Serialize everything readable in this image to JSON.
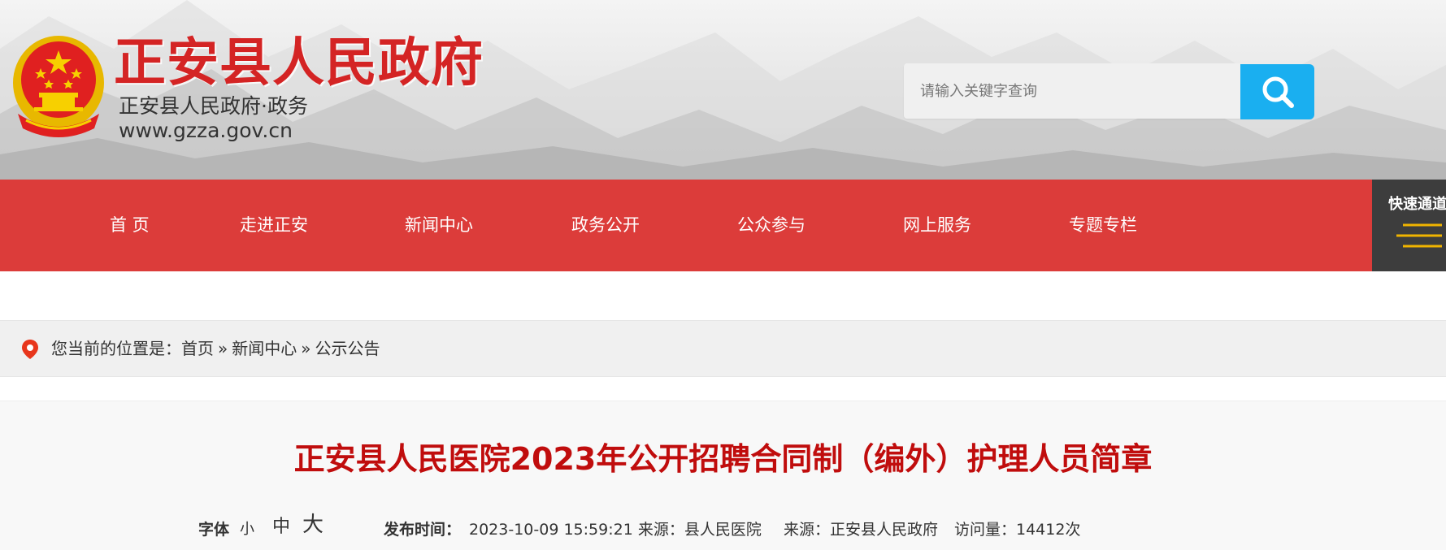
{
  "header": {
    "site_title": "正安县人民政府",
    "site_subtitle": "正安县人民政府·政务",
    "site_url": "www.gzza.gov.cn",
    "search_placeholder": "请输入关键字查询"
  },
  "nav": {
    "items": [
      "首 页",
      "走进正安",
      "新闻中心",
      "政务公开",
      "公众参与",
      "网上服务",
      "专题专栏"
    ],
    "quick_label": "快速通道"
  },
  "breadcrumb": {
    "prefix": "您当前的位置是：",
    "items": [
      "首页",
      "新闻中心",
      "公示公告"
    ],
    "separator": "»"
  },
  "article": {
    "title": "正安县人民医院2023年公开招聘合同制（编外）护理人员简章",
    "font_label": "字体",
    "font_sizes": [
      "小",
      "中",
      "大"
    ],
    "publish_label": "发布时间：",
    "publish_value": "2023-10-09 15:59:21 来源：县人民医院",
    "source_text": "来源：正安县人民政府",
    "views_text": "访问量：14412次"
  },
  "colors": {
    "brand_red": "#d42424",
    "nav_red": "#dc3c3a",
    "title_red": "#c00d0d",
    "search_blue": "#1aaff0",
    "quick_gray": "#3d3d3d",
    "quick_gold": "#f0b400"
  }
}
